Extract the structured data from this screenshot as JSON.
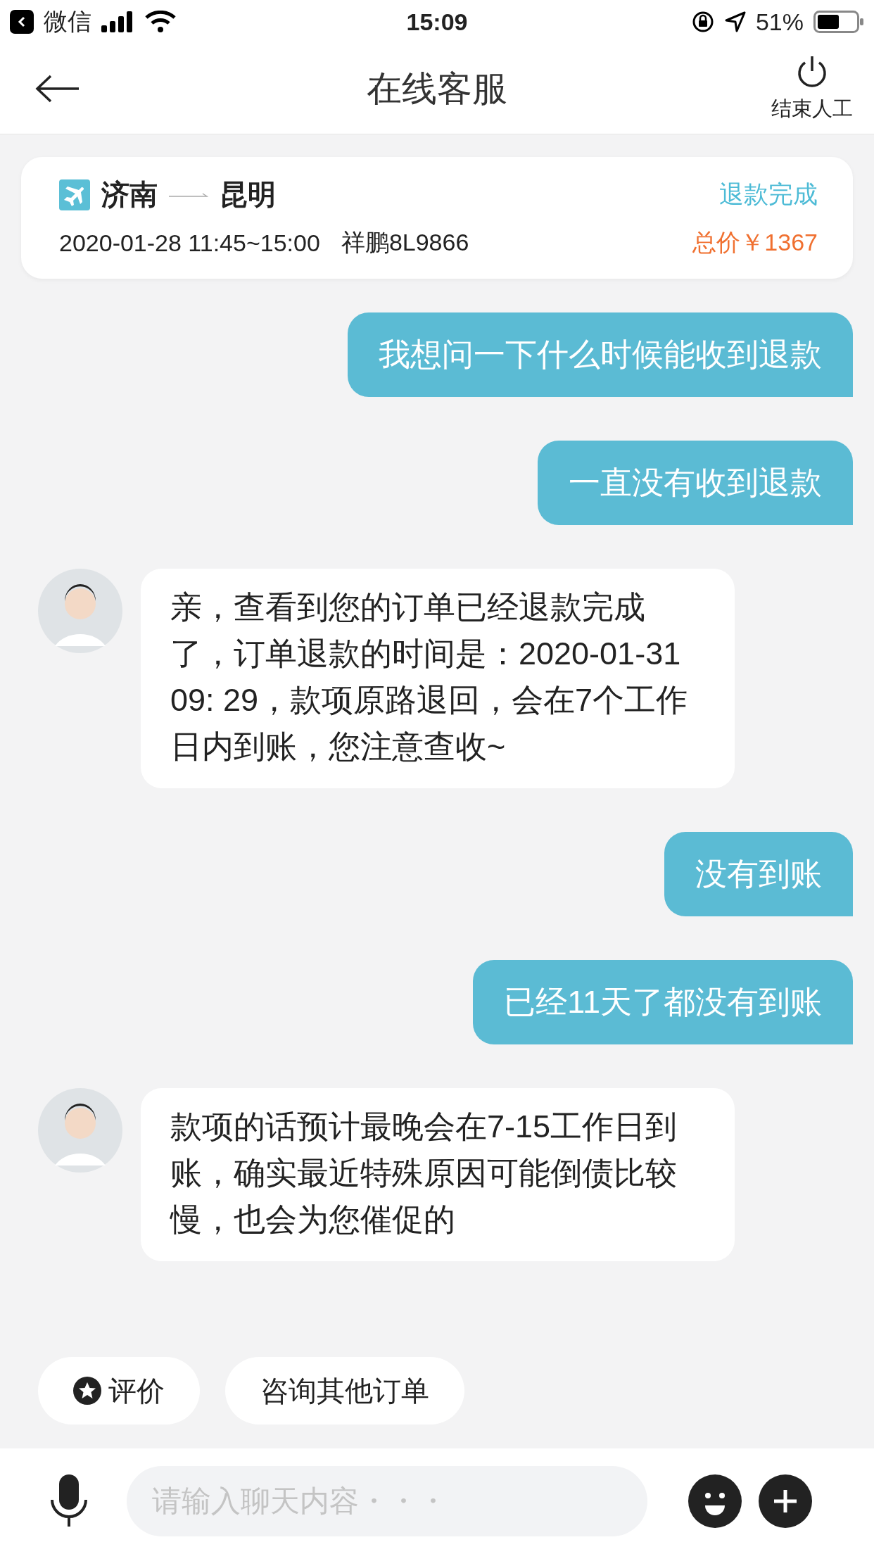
{
  "status_bar": {
    "back_app": "微信",
    "time": "15:09",
    "battery": "51%"
  },
  "header": {
    "title": "在线客服",
    "end_label": "结束人工"
  },
  "order": {
    "from": "济南",
    "to": "昆明",
    "schedule": "2020-01-28 11:45~15:00",
    "flight": "祥鹏8L9866",
    "status": "退款完成",
    "price": "总价￥1367"
  },
  "messages": [
    {
      "kind": "user",
      "text": "我想问一下什么时候能收到退款"
    },
    {
      "kind": "user",
      "text": "一直没有收到退款"
    },
    {
      "kind": "agent",
      "text": "亲，查看到您的订单已经退款完成了，订单退款的时间是：2020-01-31 09: 29，款项原路退回，会在7个工作日内到账，您注意查收~"
    },
    {
      "kind": "user",
      "text": "没有到账"
    },
    {
      "kind": "user",
      "text": "已经11天了都没有到账"
    },
    {
      "kind": "agent",
      "text": "款项的话预计最晚会在7-15工作日到账，确实最近特殊原因可能倒债比较慢，也会为您催促的"
    }
  ],
  "quick_actions": [
    {
      "kind": "rate",
      "label": "评价"
    },
    {
      "kind": "plain",
      "label": "咨询其他订单"
    }
  ],
  "input": {
    "placeholder": "请输入聊天内容・・・"
  }
}
